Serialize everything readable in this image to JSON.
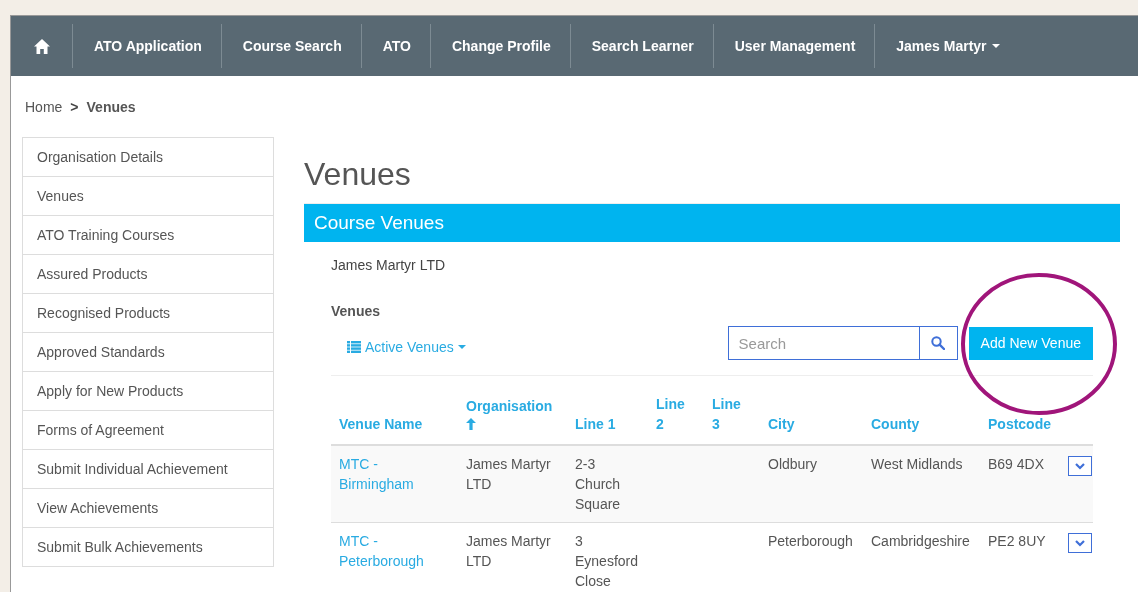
{
  "nav": {
    "items": [
      {
        "label": "ATO Application",
        "caret": false
      },
      {
        "label": "Course Search",
        "caret": false
      },
      {
        "label": "ATO",
        "caret": false
      },
      {
        "label": "Change Profile",
        "caret": false
      },
      {
        "label": "Search Learner",
        "caret": false
      },
      {
        "label": "User Management",
        "caret": false
      },
      {
        "label": "James Martyr",
        "caret": true
      }
    ]
  },
  "breadcrumb": {
    "home": "Home",
    "separator": ">",
    "current": "Venues"
  },
  "sidebar": {
    "items": [
      "Organisation Details",
      "Venues",
      "ATO Training Courses",
      "Assured Products",
      "Recognised Products",
      "Approved Standards",
      "Apply for New Products",
      "Forms of Agreement",
      "Submit Individual Achievement",
      "View Achievements",
      "Submit Bulk Achievements"
    ]
  },
  "page_title": "Venues",
  "panel": {
    "title": "Course Venues",
    "organisation": "James Martyr LTD",
    "section_label": "Venues",
    "filter": "Active Venues",
    "search": {
      "placeholder": "Search"
    },
    "add_button": "Add New Venue"
  },
  "table": {
    "columns": [
      {
        "label": "Venue Name",
        "sorted": false
      },
      {
        "label": "Organisation",
        "sorted": true
      },
      {
        "label": "Line 1",
        "sorted": false
      },
      {
        "label": "Line 2",
        "sorted": false
      },
      {
        "label": "Line 3",
        "sorted": false
      },
      {
        "label": "City",
        "sorted": false
      },
      {
        "label": "County",
        "sorted": false
      },
      {
        "label": "Postcode",
        "sorted": false
      }
    ],
    "rows": [
      {
        "cells": [
          "MTC - Birmingham",
          "James Martyr LTD",
          "2-3 Church Square",
          "",
          "",
          "Oldbury",
          "West Midlands",
          "B69 4DX"
        ]
      },
      {
        "cells": [
          "MTC - Peterborough",
          "James Martyr LTD",
          "3 Eynesford Close",
          "",
          "",
          "Peterborough",
          "Cambridgeshire",
          "PE2 8UY"
        ]
      }
    ]
  }
}
